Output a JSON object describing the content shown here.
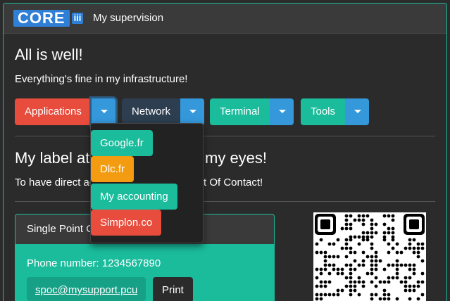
{
  "app": {
    "logo_text": "CORE",
    "logo_suffix": "iii",
    "title": "My supervision"
  },
  "status": {
    "heading": "All is well!",
    "message": "Everything's fine in my infrastructure!"
  },
  "toolbar": {
    "groups": [
      {
        "label": "Applications",
        "color": "#e74c3c",
        "toggle_color": "#3498db"
      },
      {
        "label": "Network",
        "color": "#2c3e50",
        "toggle_color": "#3498db"
      },
      {
        "label": "Terminal",
        "color": "#1abc9c",
        "toggle_color": "#3498db"
      },
      {
        "label": "Tools",
        "color": "#1abc9c",
        "toggle_color": "#3498db"
      }
    ]
  },
  "dropdown": {
    "items": [
      {
        "label": "Google.fr",
        "color": "#1abc9c"
      },
      {
        "label": "Dlc.fr",
        "color": "#f39c12"
      },
      {
        "label": "My accounting",
        "color": "#1abc9c"
      },
      {
        "label": "Simplon.co",
        "color": "#e74c3c"
      }
    ]
  },
  "contact": {
    "heading_left": "My label at",
    "heading_right": "my eyes!",
    "sub_left": "To have direct ac",
    "sub_right": "t Of Contact!",
    "card_title": "Single Point C",
    "phone": "Phone number: 1234567890",
    "email": "spoc@mysupport.pcu",
    "print_label": "Print"
  },
  "qr": {
    "icon": "qr-code"
  }
}
